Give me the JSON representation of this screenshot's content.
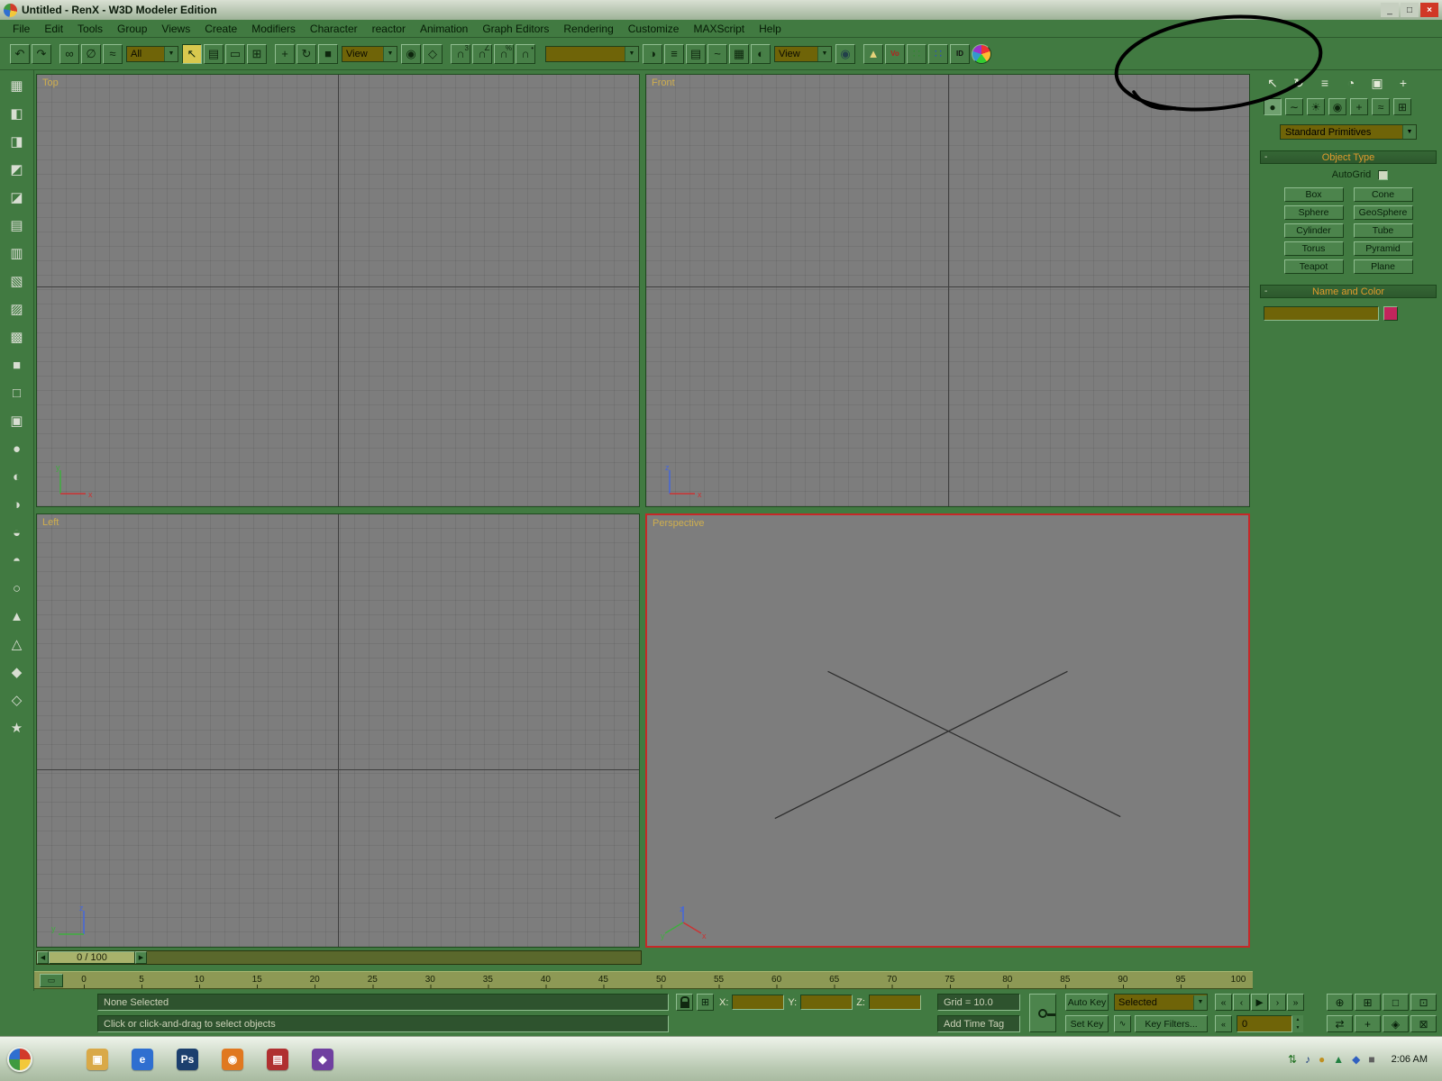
{
  "window": {
    "title": "Untitled - RenX - W3D Modeler Edition",
    "minimize": "_",
    "maximize": "□",
    "close": "×"
  },
  "menu": {
    "items": [
      "File",
      "Edit",
      "Tools",
      "Group",
      "Views",
      "Create",
      "Modifiers",
      "Character",
      "reactor",
      "Animation",
      "Graph Editors",
      "Rendering",
      "Customize",
      "MAXScript",
      "Help"
    ]
  },
  "toolbar": {
    "selection_filter": "All",
    "reference_coord": "View",
    "render_type": "View",
    "named_selection": "",
    "items": [
      {
        "t": "icon",
        "name": "undo-icon",
        "g": "↶"
      },
      {
        "t": "icon",
        "name": "redo-icon",
        "g": "↷"
      },
      {
        "t": "sep"
      },
      {
        "t": "icon",
        "name": "select-and-link-icon",
        "g": "∞"
      },
      {
        "t": "icon",
        "name": "unlink-selection-icon",
        "g": "∅"
      },
      {
        "t": "icon",
        "name": "bind-to-space-warp-icon",
        "g": "≈"
      },
      {
        "t": "dd",
        "name": "selection-filter-dropdown",
        "bind": "selection_filter",
        "cls": "w-all"
      },
      {
        "t": "icon",
        "name": "select-object-icon",
        "g": "↖",
        "pressed": true
      },
      {
        "t": "icon",
        "name": "select-by-name-icon",
        "g": "▤"
      },
      {
        "t": "icon",
        "name": "rectangular-selection-icon",
        "g": "▭"
      },
      {
        "t": "icon",
        "name": "window-crossing-icon",
        "g": "⊞"
      },
      {
        "t": "sep"
      },
      {
        "t": "icon",
        "name": "select-and-move-icon",
        "g": "+"
      },
      {
        "t": "icon",
        "name": "select-and-rotate-icon",
        "g": "↻"
      },
      {
        "t": "icon",
        "name": "select-and-scale-icon",
        "g": "■"
      },
      {
        "t": "dd",
        "name": "reference-coordinate-dropdown",
        "bind": "reference_coord",
        "cls": "w-view"
      },
      {
        "t": "icon",
        "name": "use-pivot-center-icon",
        "g": "◉"
      },
      {
        "t": "icon",
        "name": "select-and-manipulate-icon",
        "g": "◇"
      },
      {
        "t": "sep"
      },
      {
        "t": "icon",
        "name": "snap-toggle-3d-icon",
        "g": "∩",
        "sup": "3"
      },
      {
        "t": "icon",
        "name": "angle-snap-icon",
        "g": "∩",
        "sup": "∠"
      },
      {
        "t": "icon",
        "name": "percent-snap-icon",
        "g": "∩",
        "sup": "%"
      },
      {
        "t": "icon",
        "name": "spinner-snap-icon",
        "g": "∩",
        "sup": "•"
      },
      {
        "t": "sep"
      },
      {
        "t": "dd",
        "name": "named-selection-dropdown",
        "bind": "named_selection",
        "cls": "w-named"
      },
      {
        "t": "icon",
        "name": "mirror-icon",
        "g": "◑"
      },
      {
        "t": "icon",
        "name": "align-icon",
        "g": "≡"
      },
      {
        "t": "icon",
        "name": "layer-manager-icon",
        "g": "▤"
      },
      {
        "t": "icon",
        "name": "curve-editor-icon",
        "g": "~"
      },
      {
        "t": "icon",
        "name": "schematic-view-icon",
        "g": "▦"
      },
      {
        "t": "icon",
        "name": "material-editor-icon",
        "g": "◐"
      },
      {
        "t": "dd",
        "name": "render-type-dropdown",
        "bind": "render_type",
        "cls": "w-render"
      },
      {
        "t": "icon",
        "name": "camera-eye-icon",
        "g": "◉",
        "c": "#22404a"
      },
      {
        "t": "sep"
      },
      {
        "t": "icon",
        "name": "w3d-export-icon",
        "g": "▲",
        "c": "#e6d27a"
      },
      {
        "t": "icon",
        "name": "w3d-vertex-paint-icon",
        "g": "Vo",
        "txt": true,
        "c": "#b52020"
      },
      {
        "t": "icon",
        "name": "w3d-links-icon",
        "g": "∷",
        "c": "#2f8a2f"
      },
      {
        "t": "icon",
        "name": "material-navigator-icon",
        "g": "∷",
        "c": "#2f4fbf"
      },
      {
        "t": "icon",
        "name": "w3d-id-tools-icon",
        "g": "ID",
        "txt": true,
        "c": "#101010"
      },
      {
        "t": "ball",
        "name": "render-w3d-icon"
      }
    ]
  },
  "left_toolbar": {
    "icons": [
      "▦",
      "◧",
      "◨",
      "◩",
      "◪",
      "▤",
      "▥",
      "▧",
      "▨",
      "▩",
      "■",
      "□",
      "▣",
      "●",
      "◐",
      "◑",
      "◒",
      "◓",
      "○",
      "▲",
      "△",
      "◆",
      "◇",
      "★"
    ]
  },
  "viewports": {
    "top_label": "Top",
    "front_label": "Front",
    "left_label": "Left",
    "perspective_label": "Perspective",
    "active_border_color": "#c62828"
  },
  "command_panel": {
    "tabs": [
      {
        "name": "create-tab",
        "g": "↖"
      },
      {
        "name": "modify-tab",
        "g": "↻"
      },
      {
        "name": "hierarchy-tab",
        "g": "≡"
      },
      {
        "name": "motion-tab",
        "g": "◔"
      },
      {
        "name": "display-tab",
        "g": "▣"
      },
      {
        "name": "utilities-tab",
        "g": "+"
      }
    ],
    "categories": [
      {
        "name": "geometry-category",
        "g": "●",
        "pressed": true
      },
      {
        "name": "shapes-category",
        "g": "∼"
      },
      {
        "name": "lights-category",
        "g": "☀"
      },
      {
        "name": "cameras-category",
        "g": "◉"
      },
      {
        "name": "helpers-category",
        "g": "+"
      },
      {
        "name": "spacewarps-category",
        "g": "≈"
      },
      {
        "name": "systems-category",
        "g": "⊞"
      }
    ],
    "primitives_dropdown": "Standard Primitives",
    "object_type_label": "Object Type",
    "autogrid_label": "AutoGrid",
    "object_buttons": [
      "Box",
      "Cone",
      "Sphere",
      "GeoSphere",
      "Cylinder",
      "Tube",
      "Torus",
      "Pyramid",
      "Teapot",
      "Plane"
    ],
    "name_color_label": "Name and Color",
    "name_value": "",
    "swatch_color": "#c2255c",
    "rollout_text_color": "#e09a2d"
  },
  "timeline": {
    "slider_label": "0 / 100",
    "tick_labels": [
      "0",
      "5",
      "10",
      "15",
      "20",
      "25",
      "30",
      "35",
      "40",
      "45",
      "50",
      "55",
      "60",
      "65",
      "70",
      "75",
      "80",
      "85",
      "90",
      "95",
      "100"
    ]
  },
  "status": {
    "selection_text": "None Selected",
    "prompt_text": "Click or click-and-drag to select objects",
    "x_label": "X:",
    "y_label": "Y:",
    "z_label": "Z:",
    "x_value": "",
    "y_value": "",
    "z_value": "",
    "grid_text": "Grid = 10.0",
    "add_time_tag": "Add Time Tag",
    "auto_key": "Auto Key",
    "set_key": "Set Key",
    "selected_dropdown": "Selected",
    "key_filters": "Key Filters...",
    "time_value": "0",
    "playback": [
      {
        "name": "go-to-start-button",
        "g": "«"
      },
      {
        "name": "previous-frame-button",
        "g": "‹"
      },
      {
        "name": "play-button",
        "g": "▶"
      },
      {
        "name": "next-frame-button",
        "g": "›"
      },
      {
        "name": "go-to-end-button",
        "g": "»"
      }
    ],
    "nav_row1": [
      {
        "name": "zoom-icon",
        "g": "⊕"
      },
      {
        "name": "zoom-all-icon",
        "g": "⊞"
      },
      {
        "name": "zoom-extents-icon",
        "g": "□"
      },
      {
        "name": "zoom-region-icon",
        "g": "⊡"
      }
    ],
    "nav_row2": [
      {
        "name": "pan-icon",
        "g": "⇄"
      },
      {
        "name": "arc-rotate-icon",
        "g": "+"
      },
      {
        "name": "field-of-view-icon",
        "g": "◈"
      },
      {
        "name": "min-max-toggle-icon",
        "g": "⊠"
      }
    ]
  },
  "taskbar": {
    "clock": "2:06 AM",
    "quick_launch": [
      {
        "name": "folder-icon",
        "g": "▣",
        "c": "#d9a948"
      },
      {
        "name": "explorer-icon",
        "g": "e",
        "c": "#2f6fd0"
      },
      {
        "name": "photoshop-icon",
        "g": "Ps",
        "c": "#1c3f6e"
      },
      {
        "name": "browser-icon",
        "g": "◉",
        "c": "#e07820"
      },
      {
        "name": "book-icon",
        "g": "▤",
        "c": "#b03030"
      },
      {
        "name": "media-icon",
        "g": "◆",
        "c": "#7040a0"
      }
    ],
    "tray_icons": [
      {
        "name": "network-tray-icon",
        "g": "⇅",
        "c": "#207020"
      },
      {
        "name": "volume-tray-icon",
        "g": "♪",
        "c": "#204080"
      },
      {
        "name": "update-tray-icon",
        "g": "●",
        "c": "#c09020"
      },
      {
        "name": "antivirus-tray-icon",
        "g": "▲",
        "c": "#208040"
      },
      {
        "name": "messenger-tray-icon",
        "g": "◆",
        "c": "#3060c0"
      },
      {
        "name": "battery-tray-icon",
        "g": "■",
        "c": "#606060"
      }
    ]
  }
}
